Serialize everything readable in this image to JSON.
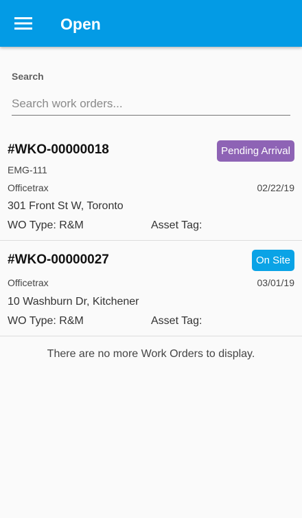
{
  "appbar": {
    "title": "Open",
    "menu_icon": "hamburger-menu-icon",
    "color": "#039be5"
  },
  "search": {
    "label": "Search",
    "placeholder": "Search work orders...",
    "value": ""
  },
  "work_orders": [
    {
      "number": "#WKO-00000018",
      "status": "Pending Arrival",
      "status_color": "#8e63b5",
      "code": "EMG-111",
      "company": "Officetrax",
      "date": "02/22/19",
      "address": "301 Front St W, Toronto",
      "wo_type": "WO Type: R&M",
      "asset_tag": "Asset Tag:"
    },
    {
      "number": "#WKO-00000027",
      "status": "On Site",
      "status_color": "#0aa3e6",
      "code": "",
      "company": "Officetrax",
      "date": "03/01/19",
      "address": "10 Washburn Dr, Kitchener",
      "wo_type": "WO Type: R&M",
      "asset_tag": "Asset Tag:"
    }
  ],
  "footer_message": "There are no more Work Orders to display."
}
